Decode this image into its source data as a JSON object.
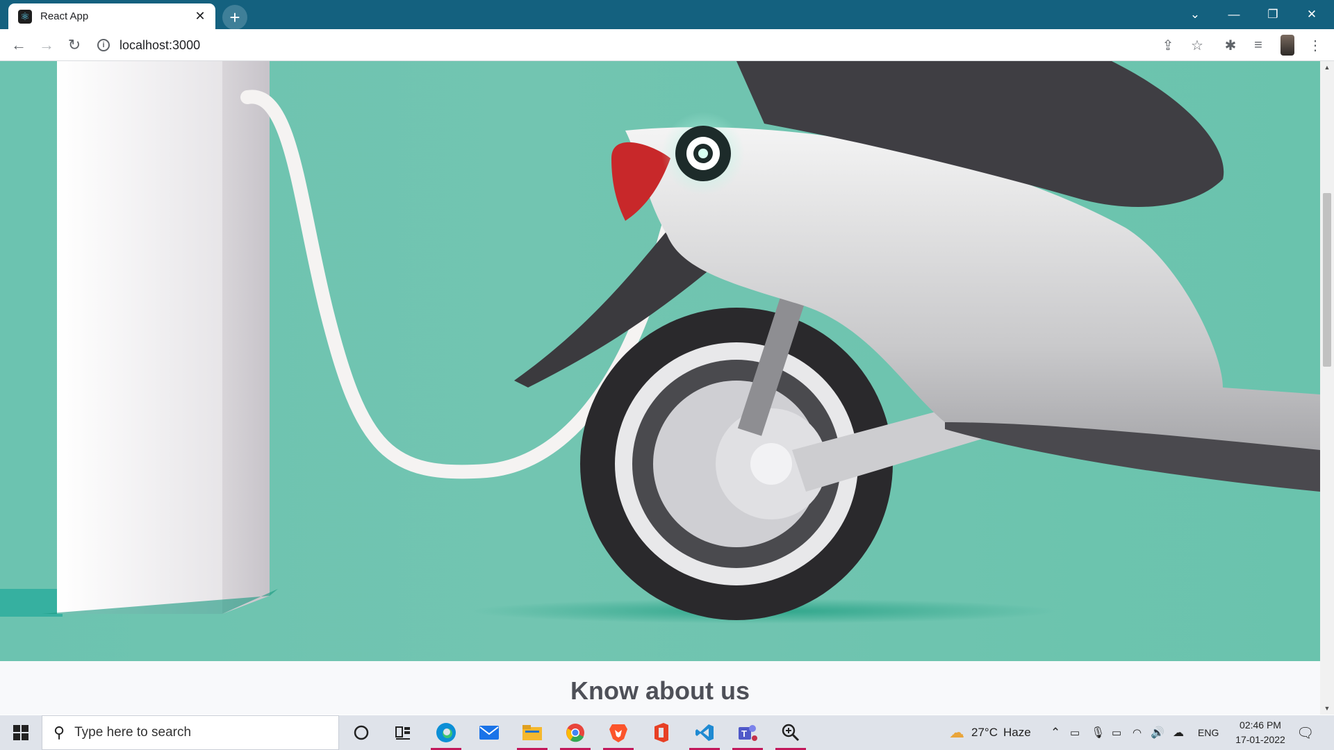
{
  "browser": {
    "tab_title": "React App",
    "favicon": "react-icon",
    "url": "localhost:3000"
  },
  "page": {
    "hero_image": "electric-scooter-charging-illustration",
    "about_title": "Know about us"
  },
  "taskbar": {
    "search_placeholder": "Type here to search",
    "weather": "27°C",
    "weather_condition": "Haze",
    "language": "ENG",
    "time": "02:46 PM",
    "date": "17-01-2022",
    "apps": [
      "cortana",
      "task-view",
      "edge",
      "mail",
      "file-explorer",
      "chrome",
      "brave",
      "office",
      "vscode",
      "teams",
      "magnifier"
    ]
  },
  "colors": {
    "titlebar": "#14617f",
    "hero_background": "#6cc3b0",
    "about_title": "#4e5058"
  }
}
